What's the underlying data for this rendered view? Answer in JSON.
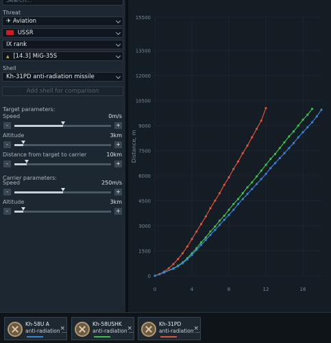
{
  "left": {
    "search_placeholder": "Search...",
    "threat_label": "Threat",
    "threat_type": "Aviation",
    "country": "USSR",
    "rank": "IX rank",
    "vehicle": "[14.3] MiG-35S",
    "shell_label": "Shell",
    "shell": "Kh-31PD anti-radiation missile",
    "add_shell": "Add shell for comparison",
    "target_params": "Target parameters:",
    "carrier_params": "Carrier parameters:",
    "sliders": [
      {
        "label": "Speed",
        "value": "0m/s",
        "level": 0.5
      },
      {
        "label": "Altitude",
        "value": "3km",
        "level": 0.09
      },
      {
        "label": "Distance from target to carrier",
        "value": "10km",
        "level": 0.13
      },
      {
        "label": "Speed",
        "value": "250m/s",
        "level": 0.5
      },
      {
        "label": "Altitude",
        "value": "3km",
        "level": 0.09
      }
    ],
    "minus": "-",
    "plus": "+"
  },
  "colors": {
    "red": "#e0533d",
    "green": "#3fbf4f",
    "blue": "#3b82d9",
    "gold": "#c9a24a"
  },
  "chart_data": {
    "type": "line",
    "ylabel": "Distance, m",
    "xlabel": "",
    "xlim": [
      0,
      18
    ],
    "ylim": [
      0,
      15500
    ],
    "x_ticks": [
      0,
      4,
      8,
      12,
      16
    ],
    "y_ticks": [
      0,
      1500,
      3000,
      4500,
      6000,
      7500,
      9000,
      10500,
      12000,
      13500,
      15500
    ],
    "series": [
      {
        "name": "Kh-31PD anti-radiation missile",
        "color": "#e0533d",
        "x": [
          0,
          0.5,
          1,
          1.5,
          2,
          2.5,
          3,
          3.5,
          4,
          4.5,
          5,
          5.5,
          6,
          6.5,
          7,
          7.5,
          8,
          8.5,
          9,
          9.5,
          10,
          10.5,
          11,
          11.5,
          12
        ],
        "y": [
          0,
          100,
          250,
          450,
          700,
          1000,
          1350,
          1750,
          2200,
          2650,
          3100,
          3550,
          4050,
          4500,
          4950,
          5450,
          5900,
          6400,
          6850,
          7350,
          7800,
          8300,
          8800,
          9300,
          10050
        ]
      },
      {
        "name": "Kh-58USHK anti-radiation missile",
        "color": "#3fbf4f",
        "x": [
          0,
          1,
          2,
          2.5,
          3,
          3.5,
          4,
          4.5,
          5,
          5.5,
          6,
          6.5,
          7,
          7.5,
          8,
          8.5,
          9,
          9.5,
          10,
          10.5,
          11,
          11.5,
          12,
          12.5,
          13,
          13.5,
          14,
          14.5,
          15,
          15.5,
          16,
          16.5,
          17
        ],
        "y": [
          0,
          200,
          450,
          600,
          800,
          1050,
          1350,
          1650,
          2000,
          2300,
          2650,
          2950,
          3300,
          3600,
          3950,
          4300,
          4600,
          4950,
          5300,
          5600,
          5950,
          6300,
          6650,
          7000,
          7300,
          7650,
          8000,
          8350,
          8650,
          9000,
          9350,
          9650,
          10000
        ]
      },
      {
        "name": "Kh-58U anti-radiation missile",
        "color": "#3b82d9",
        "x": [
          0,
          1,
          2,
          2.5,
          3,
          3.5,
          4,
          4.5,
          5,
          5.5,
          6,
          6.5,
          7,
          7.5,
          8,
          8.5,
          9,
          9.5,
          10,
          10.5,
          11,
          11.5,
          12,
          12.5,
          13,
          13.5,
          14,
          14.5,
          15,
          15.5,
          16,
          16.5,
          17,
          17.5,
          18
        ],
        "y": [
          0,
          200,
          420,
          570,
          750,
          980,
          1250,
          1550,
          1850,
          2150,
          2450,
          2750,
          3050,
          3350,
          3650,
          3950,
          4300,
          4600,
          4900,
          5200,
          5500,
          5800,
          6100,
          6450,
          6750,
          7050,
          7350,
          7650,
          7950,
          8300,
          8600,
          8900,
          9200,
          9550,
          9950
        ]
      }
    ]
  },
  "bottom": {
    "cards": [
      {
        "line1": "Kh-58U A",
        "line2": "anti-radiation ...",
        "color": "#3b82d9"
      },
      {
        "line1": "Kh-58USHK",
        "line2": "anti-radiation ...",
        "color": "#3fbf4f"
      },
      {
        "line1": "Kh-31PD",
        "line2": "anti-radiation ...",
        "color": "#e0533d"
      }
    ],
    "close": "×"
  }
}
